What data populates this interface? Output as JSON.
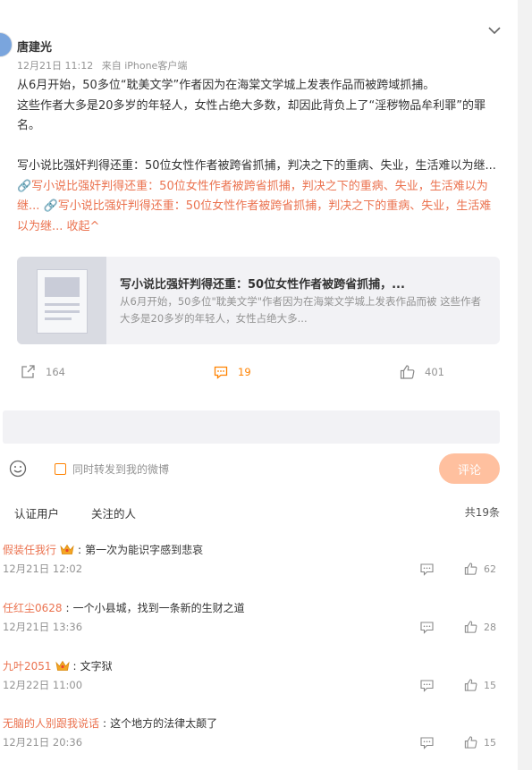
{
  "post": {
    "author": "唐建光",
    "time": "12月21日 11:12",
    "source": "来自 iPhone客户端",
    "para1": "从6月开始，50多位“耽美文学”作者因为在海棠文学城上发表作品而被跨域抓捕。",
    "para2": "这些作者大多是20多岁的年轻人，女性占绝大多数，却因此背负上了“淫秽物品牟利罪”的罪名。",
    "para3_plain": "写小说比强奸判得还重：50位女性作者被跨省抓捕，判决之下的重病、失业，生活难以为继... ",
    "para3_link1": "🔗写小说比强奸判得还重：50位女性作者被跨省抓捕，判决之下的重病、失业，生活难以为继... ",
    "para3_link2": "🔗写小说比强奸判得还重：50位女性作者被跨省抓捕，判决之下的重病、失业，生活难以为继... ",
    "collapse": "收起^"
  },
  "link_card": {
    "title": "写小说比强奸判得还重：50位女性作者被跨省抓捕，...",
    "desc": "从6月开始，50多位\"耽美文学\"作者因为在海棠文学城上发表作品而被 这些作者大多是20多岁的年轻人，女性占绝大多..."
  },
  "actions": {
    "forward_count": "164",
    "comment_count": "19",
    "like_count": "401"
  },
  "composer": {
    "forward_label": "同时转发到我的微博",
    "submit_label": "评论"
  },
  "tabs": {
    "verified": "认证用户",
    "following": "关注的人",
    "total": "共19条"
  },
  "comments": [
    {
      "user": "假装任我行",
      "has_crown": true,
      "text": "第一次为能识字感到悲哀",
      "time": "12月21日 12:02",
      "likes": "62"
    },
    {
      "user": "任红尘0628",
      "has_crown": false,
      "text": "一个小县城，找到一条新的生财之道",
      "time": "12月21日 13:36",
      "likes": "28"
    },
    {
      "user": "九叶2051",
      "has_crown": true,
      "text": "文字狱",
      "time": "12月22日 11:00",
      "likes": "15"
    },
    {
      "user": "无脑的人别跟我说话",
      "has_crown": false,
      "text": "这个地方的法律太颠了",
      "time": "12月21日 20:36",
      "likes": "15"
    }
  ],
  "colors": {
    "accent": "#ff8200",
    "link": "#eb7350",
    "submit_disabled": "#ffc09f"
  }
}
